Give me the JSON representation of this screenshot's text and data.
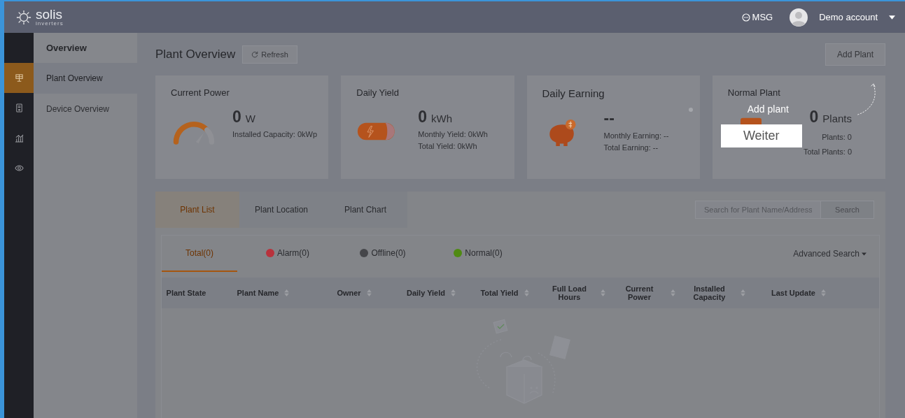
{
  "brand": {
    "name": "solis",
    "tagline": "inverters"
  },
  "header": {
    "msg": "MSG",
    "account": "Demo account"
  },
  "rail": [
    {
      "kind": "solar",
      "selected": true
    },
    {
      "kind": "device",
      "selected": false
    },
    {
      "kind": "chart",
      "selected": false
    },
    {
      "kind": "eye",
      "selected": false
    }
  ],
  "sidebar": {
    "title": "Overview",
    "items": [
      {
        "label": "Plant Overview",
        "selected": true
      },
      {
        "label": "Device Overview",
        "selected": false
      }
    ]
  },
  "page": {
    "title": "Plant Overview",
    "refresh": "Refresh",
    "add": "Add Plant"
  },
  "cards": [
    {
      "kind": "power",
      "title": "Current Power",
      "value": "0",
      "unit": "W",
      "lines": [
        "Installed Capacity: 0kWp"
      ]
    },
    {
      "kind": "yield",
      "title": "Daily Yield",
      "value": "0",
      "unit": "kWh",
      "lines": [
        "Monthly Yield: 0kWh",
        "Total Yield: 0kWh"
      ]
    },
    {
      "kind": "earning",
      "title": "Daily Earning",
      "value": "--",
      "lines": [
        "Monthly Earning: --",
        "Total Earning: --"
      ]
    },
    {
      "kind": "plants",
      "title": "Normal Plant",
      "value": "0",
      "unit": "Plants",
      "lines": [
        "Plants: 0",
        "Total Plants: 0"
      ]
    }
  ],
  "tabs": [
    {
      "label": "Plant List",
      "selected": true
    },
    {
      "label": "Plant Location",
      "selected": false
    },
    {
      "label": "Plant Chart",
      "selected": false
    }
  ],
  "search": {
    "placeholder": "Search for Plant Name/Address",
    "button": "Search"
  },
  "filters": [
    {
      "label": "Total(0)",
      "selected": true
    },
    {
      "label": "Alarm(0)",
      "color": "#b8323c",
      "selected": false
    },
    {
      "label": "Offline(0)",
      "color": "#45464a",
      "selected": false
    },
    {
      "label": "Normal(0)",
      "color": "#4f8a12",
      "selected": false
    }
  ],
  "advanced": "Advanced Search",
  "columns": [
    {
      "label": "Plant State",
      "sortable": false
    },
    {
      "label": "Plant Name",
      "sortable": true
    },
    {
      "label": "Owner",
      "sortable": true
    },
    {
      "label": "Daily Yield",
      "sortable": true
    },
    {
      "label": "Total Yield",
      "sortable": true
    },
    {
      "label": "Full Load Hours",
      "sortable": true
    },
    {
      "label": "Current Power",
      "sortable": true
    },
    {
      "label": "Installed Capacity",
      "sortable": true
    },
    {
      "label": "Last Update",
      "sortable": true
    }
  ],
  "tour": {
    "title": "Add plant",
    "button": "Weiter"
  }
}
